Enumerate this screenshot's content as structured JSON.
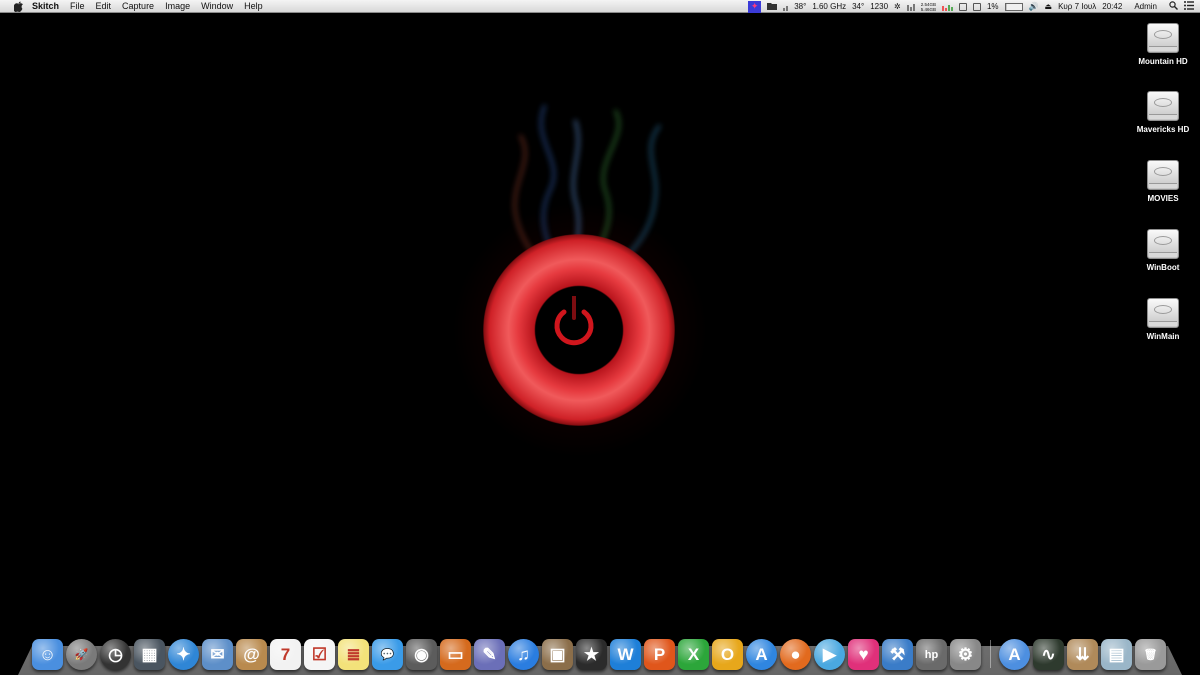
{
  "menubar": {
    "app_name": "Skitch",
    "menus": [
      "File",
      "Edit",
      "Capture",
      "Image",
      "Window",
      "Help"
    ],
    "status": {
      "cpu_temp": "38°",
      "cpu_freq": "1.60 GHz",
      "gpu_temp": "34°",
      "fan_rpm": "1230",
      "mem_used": "2.54GB",
      "mem_free": "5.46GB",
      "battery_percent": "1%",
      "battery_level": 0.01,
      "date": "Κυρ 7 Ιουλ",
      "time": "20:42",
      "user": "Admin"
    }
  },
  "desktop": {
    "drives": [
      "Mountain HD",
      "Mavericks HD",
      "MOVIES",
      "WinBoot",
      "WinMain"
    ]
  },
  "dock": {
    "apps": [
      {
        "name": "finder-icon",
        "glyph": "☺",
        "color": "#4a8fdf"
      },
      {
        "name": "launchpad-icon",
        "glyph": "🚀",
        "color": "#7a7a7a"
      },
      {
        "name": "dashboard-icon",
        "glyph": "◷",
        "color": "#333333"
      },
      {
        "name": "mission-control-icon",
        "glyph": "▦",
        "color": "#4a5560"
      },
      {
        "name": "safari-icon",
        "glyph": "✦",
        "color": "#2f86d6"
      },
      {
        "name": "mail-icon",
        "glyph": "✉",
        "color": "#5d8fc9"
      },
      {
        "name": "contacts-icon",
        "glyph": "@",
        "color": "#b98a4e"
      },
      {
        "name": "calendar-icon",
        "glyph": "7",
        "color": "#f2f2f2"
      },
      {
        "name": "reminders-icon",
        "glyph": "☑",
        "color": "#f5f5f5"
      },
      {
        "name": "notes-icon",
        "glyph": "≣",
        "color": "#f3e27a"
      },
      {
        "name": "messages-icon",
        "glyph": "💬",
        "color": "#3a9be8"
      },
      {
        "name": "facetime-icon",
        "glyph": "◉",
        "color": "#5c5c5c"
      },
      {
        "name": "keynote-icon",
        "glyph": "▭",
        "color": "#d56a1d"
      },
      {
        "name": "script-editor-icon",
        "glyph": "✎",
        "color": "#6b6fb8"
      },
      {
        "name": "itunes-icon",
        "glyph": "♫",
        "color": "#2a7de0"
      },
      {
        "name": "iphoto-icon",
        "glyph": "▣",
        "color": "#8b6e4a"
      },
      {
        "name": "imovie-icon",
        "glyph": "★",
        "color": "#2b2b2b"
      },
      {
        "name": "word-icon",
        "glyph": "W",
        "color": "#1e7fd8"
      },
      {
        "name": "powerpoint-icon",
        "glyph": "P",
        "color": "#e0561b"
      },
      {
        "name": "excel-icon",
        "glyph": "X",
        "color": "#2ca63a"
      },
      {
        "name": "outlook-icon",
        "glyph": "O",
        "color": "#e7a71b"
      },
      {
        "name": "app-store-icon",
        "glyph": "A",
        "color": "#2f86e0"
      },
      {
        "name": "firefox-icon",
        "glyph": "●",
        "color": "#e26a1e"
      },
      {
        "name": "quicktime-icon",
        "glyph": "▶",
        "color": "#4aa8e0"
      },
      {
        "name": "heart-app-icon",
        "glyph": "♥",
        "color": "#e0307a"
      },
      {
        "name": "utility-app-icon",
        "glyph": "⚒",
        "color": "#3a7cc8"
      },
      {
        "name": "hp-printer-icon",
        "glyph": "hp",
        "color": "#6a6a6a"
      },
      {
        "name": "system-preferences-icon",
        "glyph": "⚙",
        "color": "#888888"
      }
    ],
    "right_apps": [
      {
        "name": "applications-folder-icon",
        "glyph": "A",
        "color": "#4d8fe0"
      },
      {
        "name": "activity-monitor-icon",
        "glyph": "∿",
        "color": "#2e3a2e"
      },
      {
        "name": "downloads-stack-icon",
        "glyph": "⇊",
        "color": "#b08a5a"
      },
      {
        "name": "documents-stack-icon",
        "glyph": "▤",
        "color": "#9ab6c8"
      },
      {
        "name": "trash-icon",
        "glyph": "🗑",
        "color": "#9a9a9a"
      }
    ]
  }
}
